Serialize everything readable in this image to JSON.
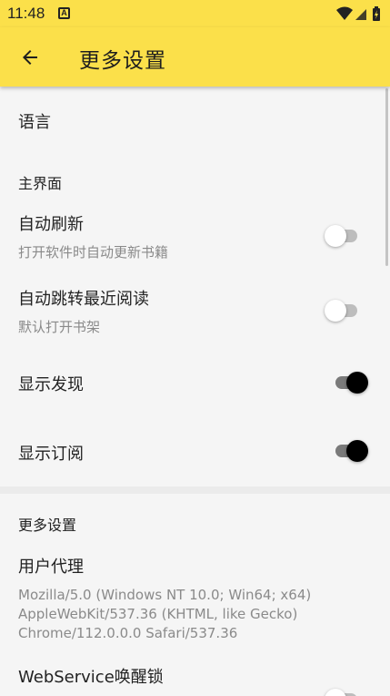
{
  "status_bar": {
    "time": "11:48",
    "notification_icon": "a-icon"
  },
  "app_bar": {
    "title": "更多设置",
    "back_icon": "arrow-left-icon",
    "bg_color": "#fbe04a"
  },
  "sections": {
    "language": {
      "title": "语言"
    },
    "main_ui": {
      "category": "主界面",
      "auto_refresh": {
        "title": "自动刷新",
        "summary": "打开软件时自动更新书籍",
        "checked": false
      },
      "auto_jump": {
        "title": "自动跳转最近阅读",
        "summary": "默认打开书架",
        "checked": false
      },
      "show_discover": {
        "title": "显示发现",
        "checked": true
      },
      "show_subscription": {
        "title": "显示订阅",
        "checked": true
      }
    },
    "more": {
      "category": "更多设置",
      "user_agent": {
        "title": "用户代理",
        "value": "Mozilla/5.0 (Windows NT 10.0; Win64; x64) AppleWebKit/537.36 (KHTML, like Gecko) Chrome/112.0.0.0 Safari/537.36"
      },
      "webservice_wakelock": {
        "title": "WebService唤醒锁",
        "checked": false
      }
    }
  }
}
